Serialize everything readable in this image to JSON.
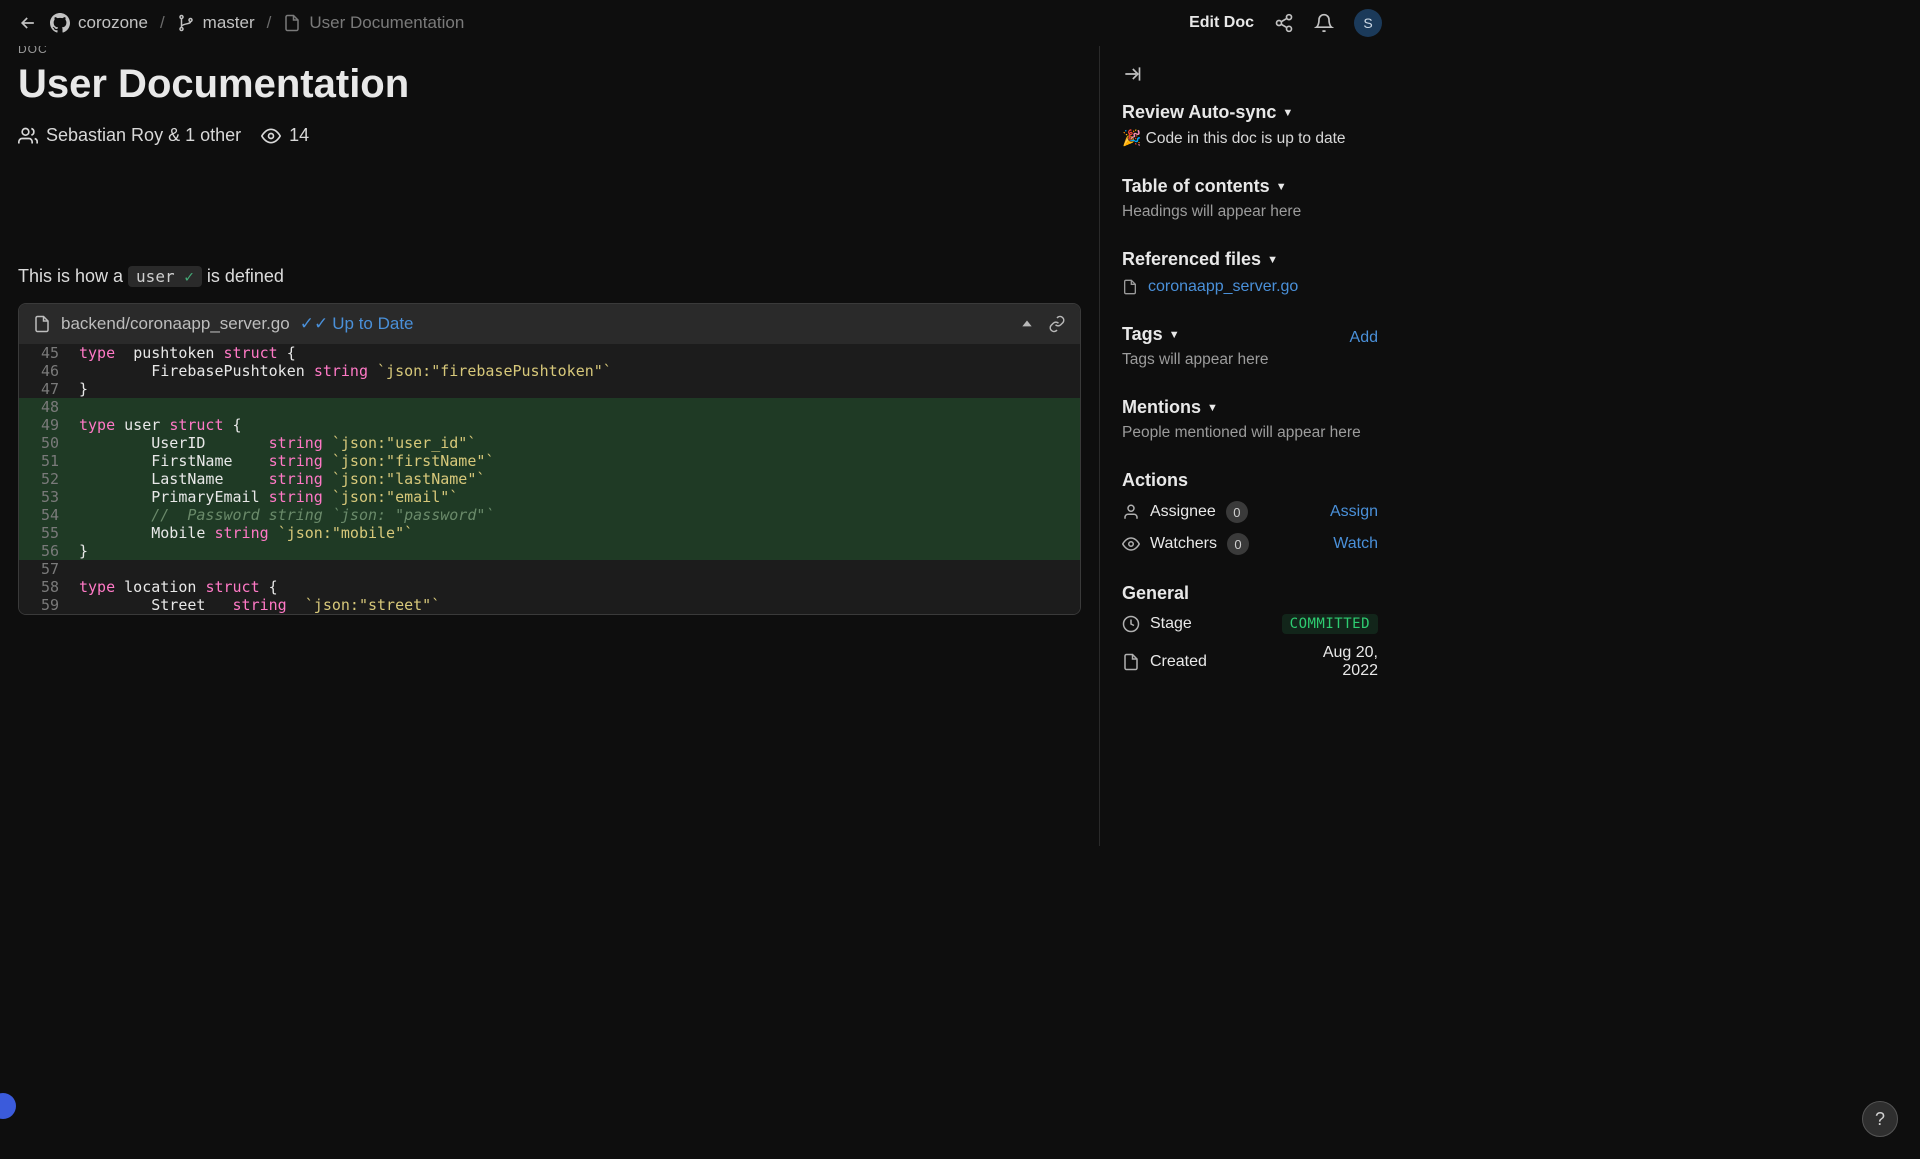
{
  "topbar": {
    "back_icon": "arrow-left",
    "breadcrumbs": {
      "repo": "corozone",
      "branch": "master",
      "doc": "User Documentation"
    },
    "edit_label": "Edit Doc",
    "avatar_initial": "S"
  },
  "doc": {
    "eyebrow": "DOC",
    "title": "User Documentation",
    "authors": "Sebastian Roy & 1 other",
    "view_count": "14",
    "body_prefix": "This is how a ",
    "body_inline_code": "user",
    "body_suffix": " is defined"
  },
  "code": {
    "file_path": "backend/coronaapp_server.go",
    "sync_label": "Up to Date",
    "lines": [
      {
        "n": "45",
        "hl": false,
        "tokens": [
          [
            "kw",
            "type"
          ],
          [
            "",
            "  "
          ],
          [
            "",
            "pushtoken"
          ],
          [
            "",
            " "
          ],
          [
            "kw",
            "struct"
          ],
          [
            "",
            " "
          ],
          [
            "punct",
            "{"
          ]
        ]
      },
      {
        "n": "46",
        "hl": false,
        "tokens": [
          [
            "",
            "        FirebasePushtoken "
          ],
          [
            "kw",
            "string"
          ],
          [
            "",
            " "
          ],
          [
            "tag",
            "`json:\"firebasePushtoken\"`"
          ]
        ]
      },
      {
        "n": "47",
        "hl": false,
        "tokens": [
          [
            "punct",
            "}"
          ]
        ]
      },
      {
        "n": "48",
        "hl": true,
        "tokens": [
          [
            "",
            ""
          ]
        ]
      },
      {
        "n": "49",
        "hl": true,
        "tokens": [
          [
            "kw",
            "type"
          ],
          [
            "",
            " "
          ],
          [
            "",
            "user"
          ],
          [
            "",
            " "
          ],
          [
            "kw",
            "struct"
          ],
          [
            "",
            " "
          ],
          [
            "punct",
            "{"
          ]
        ]
      },
      {
        "n": "50",
        "hl": true,
        "tokens": [
          [
            "",
            "        UserID       "
          ],
          [
            "kw",
            "string"
          ],
          [
            "",
            " "
          ],
          [
            "tag",
            "`json:\"user_id\"`"
          ]
        ]
      },
      {
        "n": "51",
        "hl": true,
        "tokens": [
          [
            "",
            "        FirstName    "
          ],
          [
            "kw",
            "string"
          ],
          [
            "",
            " "
          ],
          [
            "tag",
            "`json:\"firstName\"`"
          ]
        ]
      },
      {
        "n": "52",
        "hl": true,
        "tokens": [
          [
            "",
            "        LastName     "
          ],
          [
            "kw",
            "string"
          ],
          [
            "",
            " "
          ],
          [
            "tag",
            "`json:\"lastName\"`"
          ]
        ]
      },
      {
        "n": "53",
        "hl": true,
        "tokens": [
          [
            "",
            "        PrimaryEmail "
          ],
          [
            "kw",
            "string"
          ],
          [
            "",
            " "
          ],
          [
            "tag",
            "`json:\"email\"`"
          ]
        ]
      },
      {
        "n": "54",
        "hl": true,
        "tokens": [
          [
            "comment",
            "        //  Password string `json: \"password\"`"
          ]
        ]
      },
      {
        "n": "55",
        "hl": true,
        "tokens": [
          [
            "",
            "        Mobile "
          ],
          [
            "kw",
            "string"
          ],
          [
            "",
            " "
          ],
          [
            "tag",
            "`json:\"mobile\"`"
          ]
        ]
      },
      {
        "n": "56",
        "hl": true,
        "tokens": [
          [
            "punct",
            "}"
          ]
        ]
      },
      {
        "n": "57",
        "hl": false,
        "tokens": [
          [
            "",
            ""
          ]
        ]
      },
      {
        "n": "58",
        "hl": false,
        "tokens": [
          [
            "kw",
            "type"
          ],
          [
            "",
            " "
          ],
          [
            "",
            "location"
          ],
          [
            "",
            " "
          ],
          [
            "kw",
            "struct"
          ],
          [
            "",
            " "
          ],
          [
            "punct",
            "{"
          ]
        ]
      },
      {
        "n": "59",
        "hl": false,
        "tokens": [
          [
            "",
            "        Street   "
          ],
          [
            "kw",
            "string"
          ],
          [
            "",
            "  "
          ],
          [
            "tag",
            "`json:\"street\"`"
          ]
        ]
      }
    ]
  },
  "sidebar": {
    "review": {
      "heading": "Review Auto-sync",
      "status_emoji": "🎉",
      "status_text": "Code in this doc is up to date"
    },
    "toc": {
      "heading": "Table of contents",
      "empty": "Headings will appear here"
    },
    "referenced": {
      "heading": "Referenced files",
      "files": [
        "coronaapp_server.go"
      ]
    },
    "tags": {
      "heading": "Tags",
      "add_label": "Add",
      "empty": "Tags will appear here"
    },
    "mentions": {
      "heading": "Mentions",
      "empty": "People mentioned will appear here"
    },
    "actions": {
      "heading": "Actions",
      "assignee_label": "Assignee",
      "assignee_count": "0",
      "assign_action": "Assign",
      "watchers_label": "Watchers",
      "watchers_count": "0",
      "watch_action": "Watch"
    },
    "general": {
      "heading": "General",
      "stage_label": "Stage",
      "stage_value": "COMMITTED",
      "created_label": "Created",
      "created_value": "Aug 20, 2022"
    }
  },
  "help_label": "?"
}
